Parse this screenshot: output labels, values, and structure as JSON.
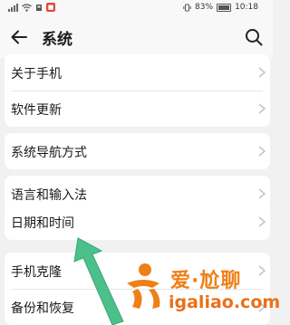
{
  "status_bar": {
    "left_indicators": [
      "signal-icon",
      "wifi-icon",
      "notification-icon",
      "app-badge-icon"
    ],
    "battery_level": "83%",
    "time": "10:18"
  },
  "header": {
    "title": "系统",
    "back_icon": "back-arrow-icon",
    "search_icon": "search-icon"
  },
  "groups": [
    {
      "items": [
        {
          "label": "关于手机"
        },
        {
          "label": "软件更新"
        }
      ]
    },
    {
      "items": [
        {
          "label": "系统导航方式"
        }
      ]
    },
    {
      "items": [
        {
          "label": "语言和输入法"
        }
      ]
    },
    {
      "items": [
        {
          "label": "日期和时间"
        }
      ]
    },
    {
      "items": [
        {
          "label": "手机克隆"
        },
        {
          "label": "备份和恢复"
        }
      ]
    }
  ],
  "watermark": {
    "line1": "爱·尬聊",
    "line2": "igaliao.com"
  },
  "colors": {
    "arrow": "#4cc08a",
    "watermark": "#ef7f17",
    "background": "#f1f1f1"
  }
}
